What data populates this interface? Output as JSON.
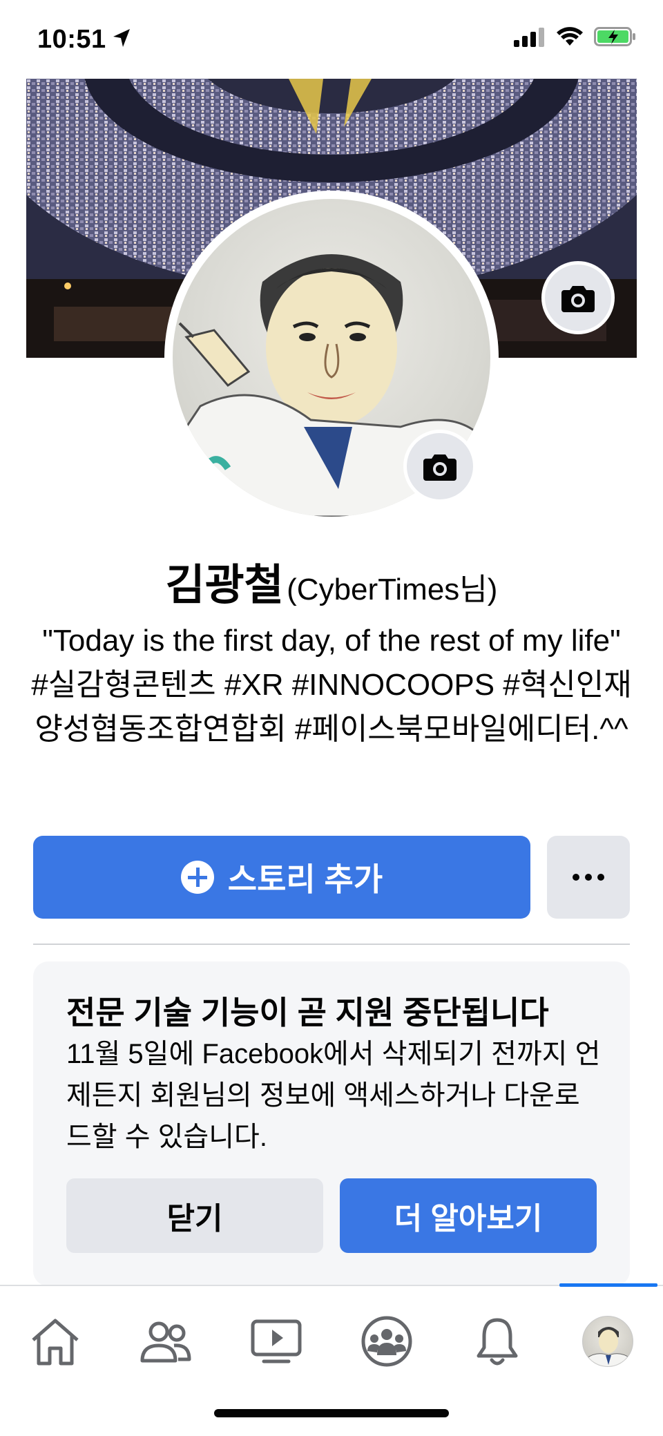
{
  "status_bar": {
    "time": "10:51",
    "icons": [
      "location-arrow-icon",
      "signal-icon",
      "wifi-icon",
      "battery-charging-icon"
    ]
  },
  "profile": {
    "name": "김광철",
    "alt_name": "(CyberTimes님)",
    "bio": "\"Today is the first day, of the rest of my life\" #실감형콘텐츠 #XR #INNOCOOPS #혁신인재양성협동조합연합회 #페이스북모바일에디터.^^",
    "cover_camera_icon": "camera-icon",
    "avatar_camera_icon": "camera-icon"
  },
  "actions": {
    "add_story_label": "스토리 추가",
    "more_icon": "more-icon"
  },
  "notice": {
    "title": "전문 기술 기능이 곧 지원 중단됩니다",
    "body": "11월 5일에 Facebook에서 삭제되기 전까지 언제든지 회원님의 정보에 액세스하거나 다운로드할 수 있습니다.",
    "close_label": "닫기",
    "learn_more_label": "더 알아보기"
  },
  "tab_bar": {
    "tabs": [
      "home-icon",
      "friends-icon",
      "watch-icon",
      "groups-icon",
      "notifications-icon",
      "profile-avatar"
    ],
    "active_tab": "profile-avatar"
  },
  "colors": {
    "accent": "#3a77e4",
    "button_gray": "#e4e6eb",
    "card_bg": "#f5f6f8"
  }
}
